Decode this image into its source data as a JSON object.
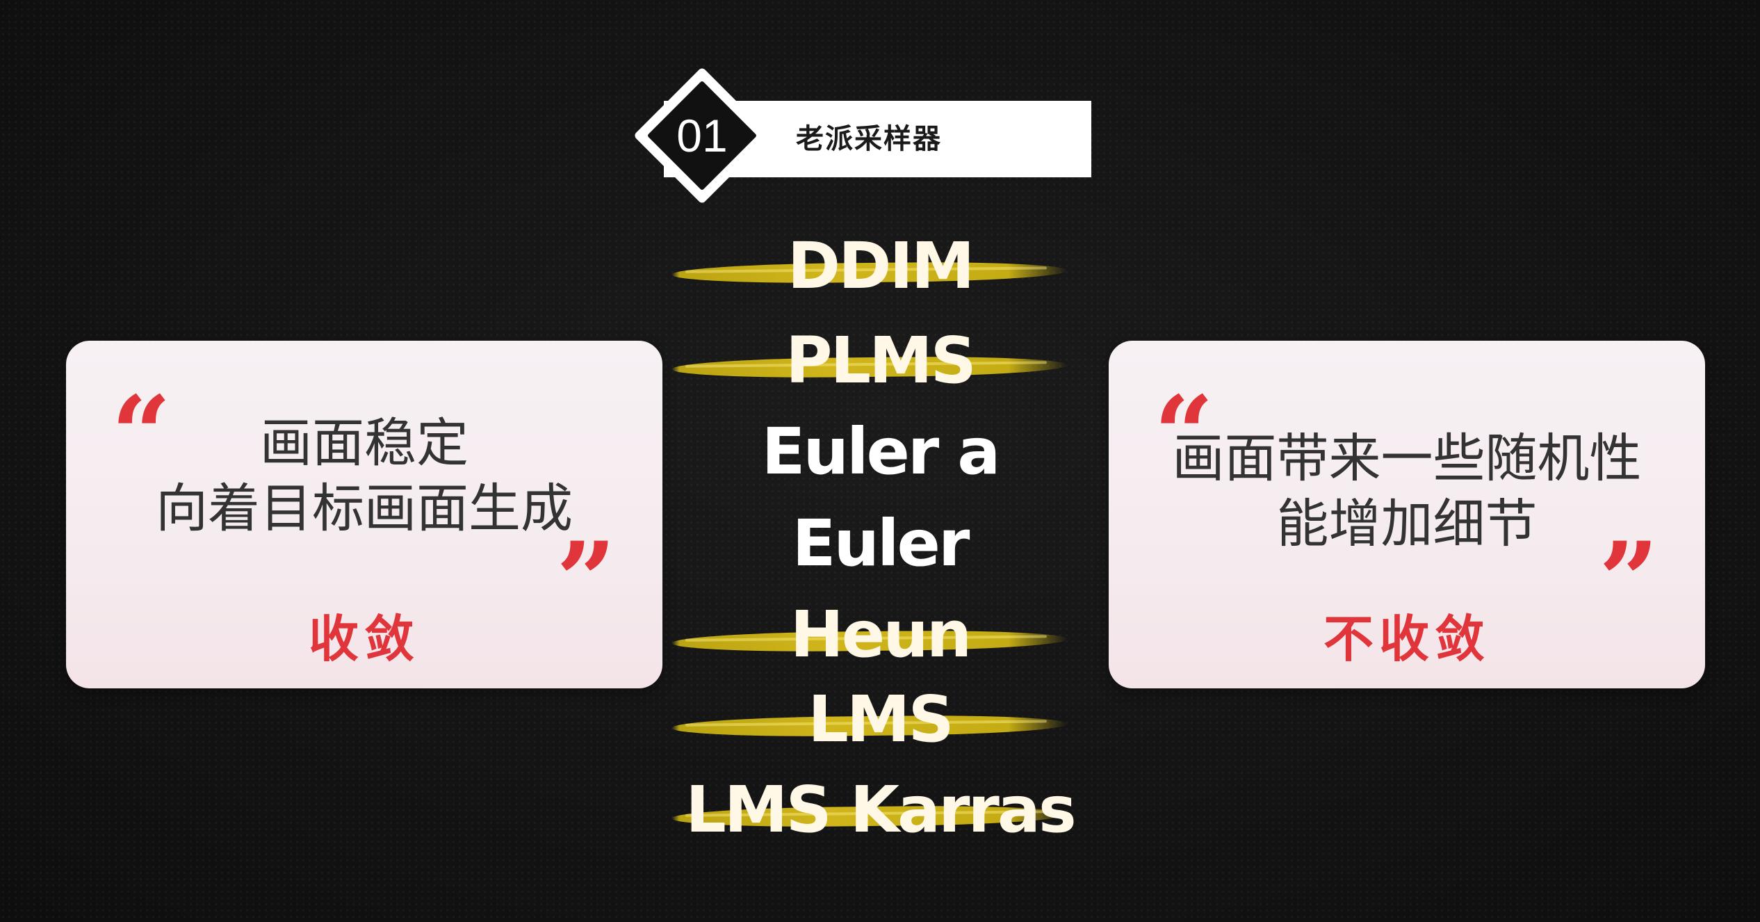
{
  "header": {
    "number": "01",
    "title": "老派采样器"
  },
  "left_card": {
    "open_quote": "“",
    "line1": "画面稳定",
    "line2": "向着目标画面生成",
    "close_quote": "”",
    "verdict": "收敛"
  },
  "right_card": {
    "open_quote": "“",
    "line1": "画面带来一些随机性",
    "line2": "能增加细节",
    "close_quote": "”",
    "verdict": "不收敛"
  },
  "samplers": [
    {
      "label": "DDIM",
      "struck": true
    },
    {
      "label": "PLMS",
      "struck": true
    },
    {
      "label": "Euler a",
      "struck": false
    },
    {
      "label": "Euler",
      "struck": false
    },
    {
      "label": "Heun",
      "struck": true
    },
    {
      "label": "LMS",
      "struck": true
    },
    {
      "label": "LMS Karras",
      "struck": true
    }
  ],
  "colors": {
    "background": "#141414",
    "accent_red": "#e0353a",
    "strike_yellow": "#d4b81c",
    "card_bg": "#f6eef1"
  }
}
